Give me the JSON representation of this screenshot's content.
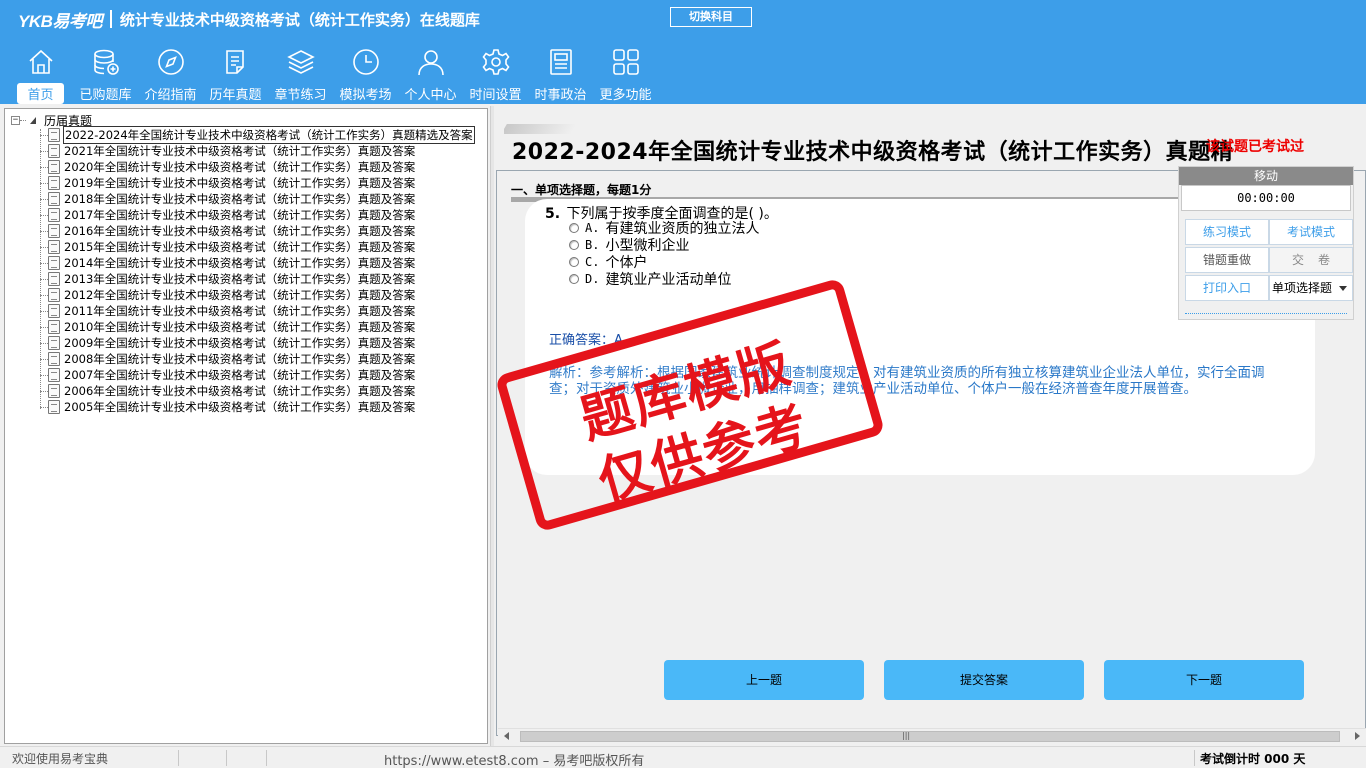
{
  "brand": {
    "logo": "YKB易考吧",
    "title": "统计专业技术中级资格考试（统计工作实务）在线题库"
  },
  "header": {
    "switch_label": "切换科目"
  },
  "nav": [
    {
      "label": "首页",
      "icon": "home-icon"
    },
    {
      "label": "已购题库",
      "icon": "database-icon"
    },
    {
      "label": "介绍指南",
      "icon": "compass-icon"
    },
    {
      "label": "历年真题",
      "icon": "document-list-icon"
    },
    {
      "label": "章节练习",
      "icon": "layers-icon"
    },
    {
      "label": "模拟考场",
      "icon": "clock-icon"
    },
    {
      "label": "个人中心",
      "icon": "user-icon"
    },
    {
      "label": "时间设置",
      "icon": "gear-icon"
    },
    {
      "label": "时事政治",
      "icon": "news-icon"
    },
    {
      "label": "更多功能",
      "icon": "grid-icon"
    }
  ],
  "tree": {
    "root": "历届真题",
    "items": [
      "2022-2024年全国统计专业技术中级资格考试（统计工作实务）真题精选及答案",
      "2021年全国统计专业技术中级资格考试（统计工作实务）真题及答案",
      "2020年全国统计专业技术中级资格考试（统计工作实务）真题及答案",
      "2019年全国统计专业技术中级资格考试（统计工作实务）真题及答案",
      "2018年全国统计专业技术中级资格考试（统计工作实务）真题及答案",
      "2017年全国统计专业技术中级资格考试（统计工作实务）真题及答案",
      "2016年全国统计专业技术中级资格考试（统计工作实务）真题及答案",
      "2015年全国统计专业技术中级资格考试（统计工作实务）真题及答案",
      "2014年全国统计专业技术中级资格考试（统计工作实务）真题及答案",
      "2013年全国统计专业技术中级资格考试（统计工作实务）真题及答案",
      "2012年全国统计专业技术中级资格考试（统计工作实务）真题及答案",
      "2011年全国统计专业技术中级资格考试（统计工作实务）真题及答案",
      "2010年全国统计专业技术中级资格考试（统计工作实务）真题及答案",
      "2009年全国统计专业技术中级资格考试（统计工作实务）真题及答案",
      "2008年全国统计专业技术中级资格考试（统计工作实务）真题及答案",
      "2007年全国统计专业技术中级资格考试（统计工作实务）真题及答案",
      "2006年全国统计专业技术中级资格考试（统计工作实务）真题及答案",
      "2005年全国统计专业技术中级资格考试（统计工作实务）真题及答案"
    ]
  },
  "question_area": {
    "title": "2022-2024年全国统计专业技术中级资格考试（统计工作实务）真题精",
    "title_overlay": "该试题已考试过",
    "section": "一、单项选择题，每题1分",
    "number": "5.",
    "text": "下列属于按季度全面调查的是(  )。",
    "options": [
      {
        "letter": "A.",
        "text": "有建筑业资质的独立法人"
      },
      {
        "letter": "B.",
        "text": "小型微利企业"
      },
      {
        "letter": "C.",
        "text": "个体户"
      },
      {
        "letter": "D.",
        "text": "建筑业产业活动单位"
      }
    ],
    "answer_label": "正确答案：A",
    "analysis": "解析：参考解析：根据国家建筑业统计调查制度规定，对有建筑业资质的所有独立核算建筑业企业法人单位，实行全面调查；对于资质外建筑业小微企业，用抽样调查；建筑业产业活动单位、个体户一般在经济普查年度开展普查。"
  },
  "control_panel": {
    "move_label": "移动",
    "timer": "00:00:00",
    "practice_mode": "练习模式",
    "exam_mode": "考试模式",
    "redo_wrong": "错题重做",
    "submit_paper": "交卷",
    "print": "打印入口",
    "type_select": "单项选择题"
  },
  "buttons": {
    "prev": "上一题",
    "submit": "提交答案",
    "next": "下一题"
  },
  "watermark": {
    "line1": "题库模版",
    "line2": "仅供参考"
  },
  "status": {
    "welcome": "欢迎使用易考宝典",
    "url": "https://www.etest8.com – 易考吧版权所有",
    "countdown": "考试倒计时 000 天"
  },
  "colors": {
    "header_blue": "#3d9ee9",
    "button_blue": "#4ab8f8",
    "stamp_red": "#e5141b",
    "warning_red": "#e00000"
  }
}
